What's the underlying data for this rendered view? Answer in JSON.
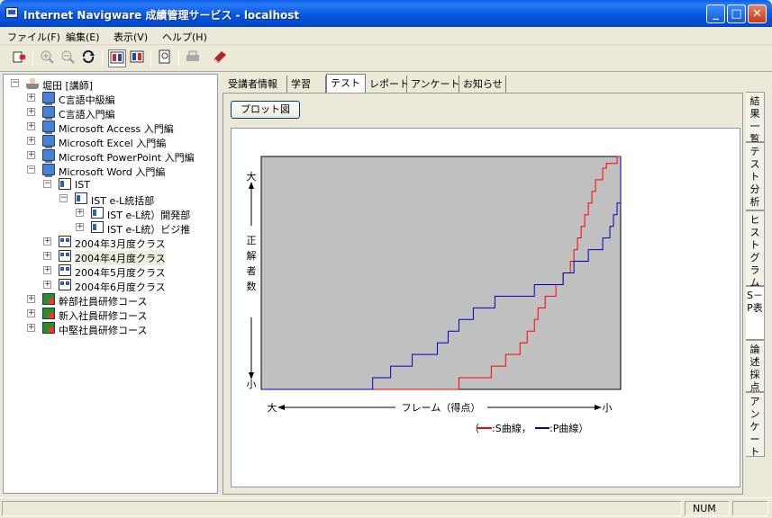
{
  "window": {
    "title": "Internet Navigware 成績管理サービス - localhost",
    "minimize": "_",
    "maximize": "□",
    "close": "✕"
  },
  "menu": [
    "ファイル(F)",
    "編集(E)",
    "表示(V)",
    "ヘルプ(H)"
  ],
  "toolbar": {
    "icons": [
      "exit-icon",
      "zoom-in-icon",
      "zoom-out-icon",
      "refresh-icon",
      "sp-table-icon",
      "compare-icon",
      "preview-icon",
      "print-icon",
      "book-icon"
    ],
    "pressed": [
      "sp-table-icon"
    ]
  },
  "tree": {
    "root": "堀田 [講師]",
    "items": [
      {
        "label": "C言語中級編",
        "level": 1,
        "icon": "pc",
        "expanded": false
      },
      {
        "label": "C言語入門編",
        "level": 1,
        "icon": "pc",
        "expanded": false
      },
      {
        "label": "Microsoft Access 入門編",
        "level": 1,
        "icon": "pc",
        "expanded": false
      },
      {
        "label": "Microsoft Excel 入門編",
        "level": 1,
        "icon": "pc",
        "expanded": false
      },
      {
        "label": "Microsoft PowerPoint 入門編",
        "level": 1,
        "icon": "pc",
        "expanded": false
      },
      {
        "label": "Microsoft Word 入門編",
        "level": 1,
        "icon": "pc",
        "expanded": true
      },
      {
        "label": "IST",
        "level": 2,
        "icon": "org",
        "expanded": true
      },
      {
        "label": "IST e-L統括部",
        "level": 3,
        "icon": "org",
        "expanded": true
      },
      {
        "label": "IST e-L統）開発部",
        "level": 4,
        "icon": "org",
        "expanded": false
      },
      {
        "label": "IST e-L統）ビジ推",
        "level": 4,
        "icon": "org",
        "expanded": false
      },
      {
        "label": "2004年3月度クラス",
        "level": 2,
        "icon": "class",
        "expanded": false
      },
      {
        "label": "2004年4月度クラス",
        "level": 2,
        "icon": "class",
        "expanded": false,
        "highlight": true
      },
      {
        "label": "2004年5月度クラス",
        "level": 2,
        "icon": "class",
        "expanded": false
      },
      {
        "label": "2004年6月度クラス",
        "level": 2,
        "icon": "class",
        "expanded": false
      },
      {
        "label": "幹部社員研修コース",
        "level": 1,
        "icon": "group",
        "expanded": false
      },
      {
        "label": "新入社員研修コース",
        "level": 1,
        "icon": "group",
        "expanded": false
      },
      {
        "label": "中堅社員研修コース",
        "level": 1,
        "icon": "group",
        "expanded": false
      }
    ]
  },
  "tabs": [
    {
      "label": "受講者情報",
      "active": false
    },
    {
      "label": "学習",
      "active": false
    },
    {
      "label": "テスト",
      "active": true
    },
    {
      "label": "レポート",
      "active": false
    },
    {
      "label": "アンケート",
      "active": false
    },
    {
      "label": "お知らせ",
      "active": false
    }
  ],
  "plot_button": "プロット図",
  "vertical_tabs": [
    {
      "label": "結果一覧",
      "active": false
    },
    {
      "label": "テスト分析",
      "active": false
    },
    {
      "label": "ヒストグラム",
      "active": false
    },
    {
      "label": "S－P表",
      "active": true
    },
    {
      "label": "論述採点",
      "active": false
    },
    {
      "label": "アンケート",
      "active": false
    }
  ],
  "chart_data": {
    "type": "line",
    "title": "",
    "xlabel": "フレーム（得点）",
    "ylabel": "正解者数",
    "x_left_label": "大",
    "x_right_label": "小",
    "y_top_label": "大",
    "y_bottom_label": "小",
    "legend_open": "（",
    "legend_close": "）",
    "legend_sep": "，",
    "xlim": [
      0,
      100
    ],
    "ylim": [
      0,
      100
    ],
    "plot_background": "#c0c0c0",
    "series": [
      {
        "name": "S曲線",
        "color": "#ff0000",
        "points": [
          [
            31,
            0
          ],
          [
            55,
            0
          ],
          [
            55,
            5
          ],
          [
            64,
            5
          ],
          [
            64,
            10
          ],
          [
            68,
            10
          ],
          [
            68,
            15
          ],
          [
            72,
            15
          ],
          [
            72,
            20
          ],
          [
            74,
            20
          ],
          [
            74,
            25
          ],
          [
            76,
            25
          ],
          [
            76,
            30
          ],
          [
            77,
            30
          ],
          [
            77,
            35
          ],
          [
            79,
            35
          ],
          [
            79,
            40
          ],
          [
            82,
            40
          ],
          [
            82,
            45
          ],
          [
            84,
            45
          ],
          [
            84,
            50
          ],
          [
            86,
            50
          ],
          [
            86,
            55
          ],
          [
            87,
            55
          ],
          [
            87,
            60
          ],
          [
            88,
            60
          ],
          [
            88,
            65
          ],
          [
            89,
            65
          ],
          [
            89,
            70
          ],
          [
            90,
            70
          ],
          [
            90,
            75
          ],
          [
            91,
            75
          ],
          [
            91,
            80
          ],
          [
            92,
            80
          ],
          [
            92,
            85
          ],
          [
            93,
            85
          ],
          [
            93,
            90
          ],
          [
            95,
            90
          ],
          [
            95,
            95
          ],
          [
            96,
            95
          ],
          [
            96,
            97
          ],
          [
            99,
            97
          ],
          [
            99,
            100
          ],
          [
            100,
            100
          ]
        ]
      },
      {
        "name": "P曲線",
        "color": "#0000c0",
        "points": [
          [
            0,
            0
          ],
          [
            31,
            0
          ],
          [
            31,
            5
          ],
          [
            36,
            5
          ],
          [
            36,
            10
          ],
          [
            42,
            10
          ],
          [
            42,
            15
          ],
          [
            49,
            15
          ],
          [
            49,
            20
          ],
          [
            52,
            20
          ],
          [
            52,
            25
          ],
          [
            55,
            25
          ],
          [
            55,
            30
          ],
          [
            59,
            30
          ],
          [
            59,
            35
          ],
          [
            65,
            35
          ],
          [
            65,
            40
          ],
          [
            76,
            40
          ],
          [
            76,
            45
          ],
          [
            84,
            45
          ],
          [
            84,
            50
          ],
          [
            87,
            50
          ],
          [
            87,
            55
          ],
          [
            91,
            55
          ],
          [
            91,
            60
          ],
          [
            95,
            60
          ],
          [
            95,
            65
          ],
          [
            97,
            65
          ],
          [
            97,
            70
          ],
          [
            98,
            70
          ],
          [
            98,
            75
          ],
          [
            99,
            75
          ],
          [
            99,
            80
          ],
          [
            100,
            80
          ],
          [
            100,
            100
          ]
        ]
      }
    ]
  },
  "status": {
    "num": "NUM"
  }
}
